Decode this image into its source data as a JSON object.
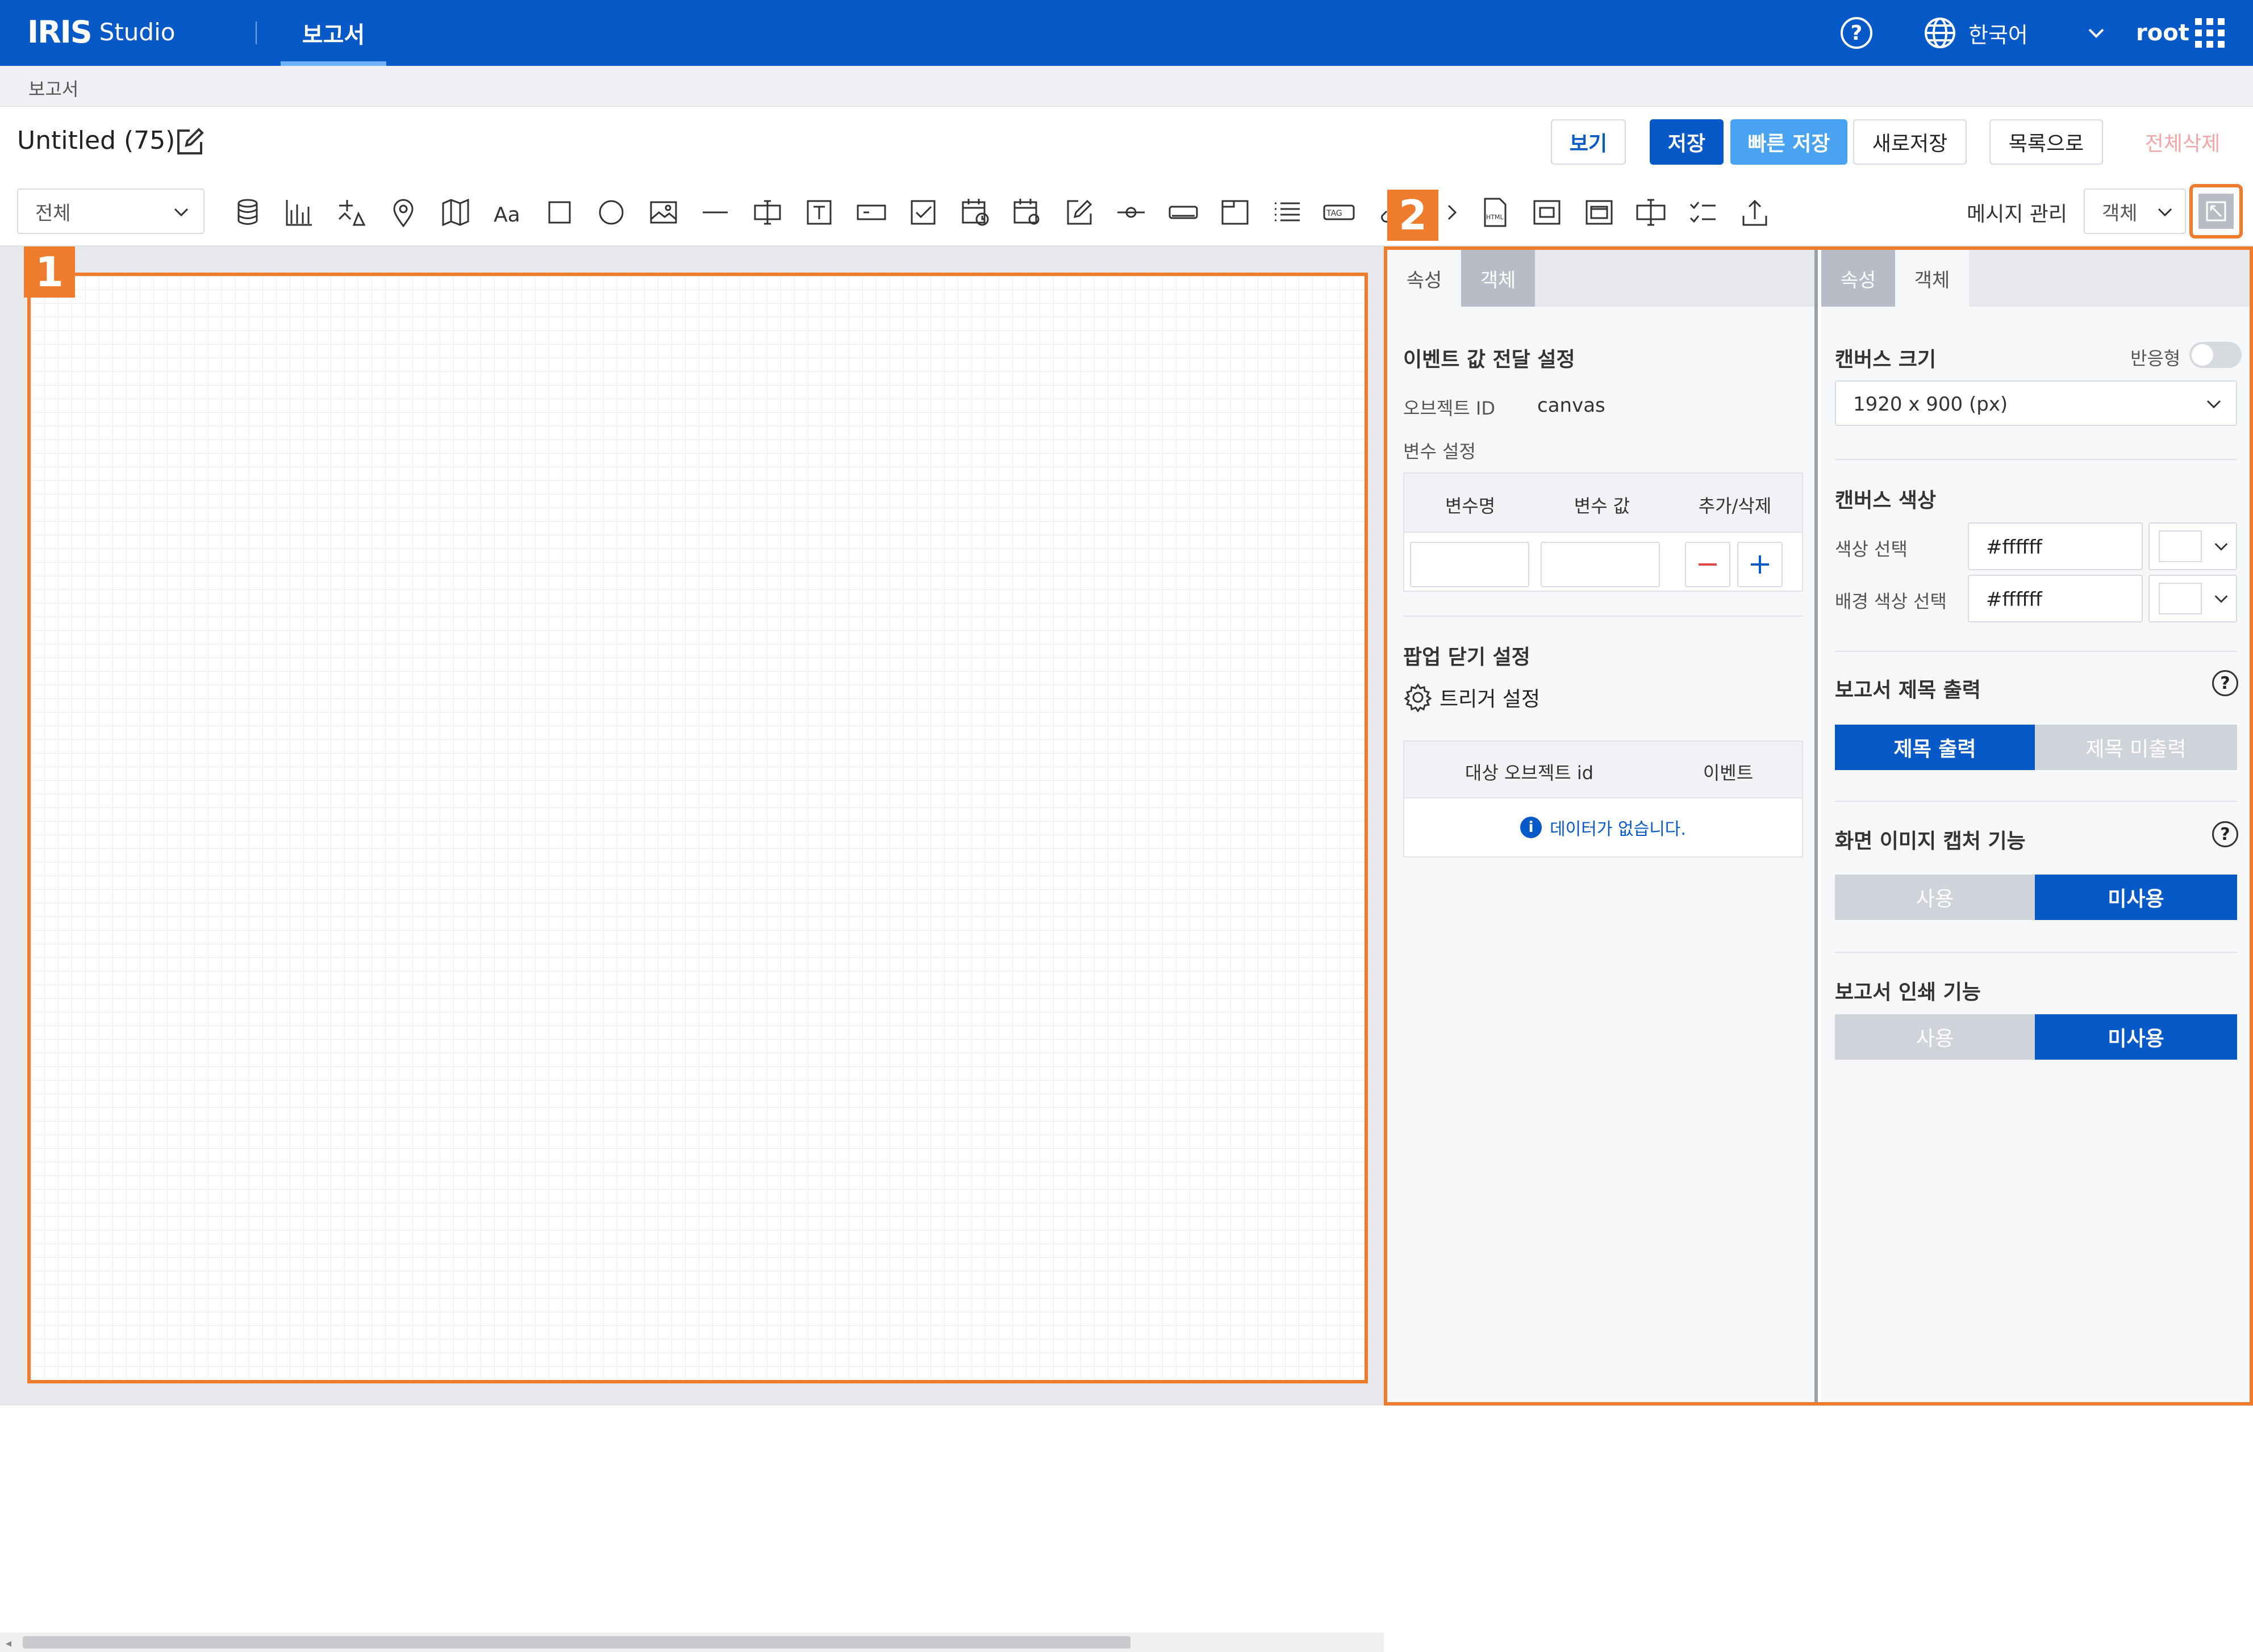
{
  "app": {
    "logo_mark": "IRIS",
    "logo_text": "Studio",
    "nav_tab": "보고서",
    "language": "한국어",
    "user": "root"
  },
  "breadcrumb": "보고서",
  "document": {
    "title": "Untitled (75)"
  },
  "actions": {
    "view": "보기",
    "save": "저장",
    "quick_save": "빠른 저장",
    "save_new": "새로저장",
    "to_list": "목록으로",
    "delete_all": "전체삭제"
  },
  "toolbar": {
    "filter_select": "전체",
    "message_manage": "메시지 관리",
    "object_select": "객체",
    "tools": [
      "database-icon",
      "bar-chart-icon",
      "filter-chart-icon",
      "map-pin-icon",
      "map-icon",
      "text-icon",
      "rectangle-icon",
      "circle-icon",
      "image-icon",
      "line-icon",
      "input-box-icon",
      "textbox-icon",
      "field-icon",
      "checkbox-icon",
      "date-icon",
      "datetime-icon",
      "edit-icon",
      "slider-icon",
      "button-icon",
      "tab-panel-icon",
      "list-icon",
      "tag-icon",
      "link-icon",
      "code-icon",
      "html-icon",
      "frame-icon",
      "popup-icon",
      "cursor-text-icon",
      "checklist-icon",
      "upload-icon"
    ]
  },
  "markers": {
    "canvas": "1",
    "panel": "2"
  },
  "left_panel": {
    "tab_props": "속성",
    "tab_object": "객체",
    "event_section": "이벤트 값 전달 설정",
    "object_id_label": "오브젝트 ID",
    "object_id_value": "canvas",
    "var_section": "변수 설정",
    "var_columns": [
      "변수명",
      "변수 값",
      "추가/삭제"
    ],
    "popup_section": "팝업 닫기 설정",
    "trigger_label": "트리거 설정",
    "trigger_columns": [
      "대상 오브젝트 id",
      "이벤트"
    ],
    "no_data": "데이터가 없습니다."
  },
  "right_panel": {
    "tab_props": "속성",
    "tab_object": "객체",
    "canvas_size_label": "캔버스 크기",
    "responsive_label": "반응형",
    "responsive_on": false,
    "canvas_size_value": "1920 x 900 (px)",
    "canvas_color_label": "캔버스 색상",
    "color_select_label": "색상 선택",
    "color_value": "#ffffff",
    "bg_color_label": "배경 색상 선택",
    "bg_color_value": "#ffffff",
    "title_output_label": "보고서 제목 출력",
    "title_on": "제목 출력",
    "title_off": "제목 미출력",
    "capture_label": "화면 이미지 캡처 기능",
    "capture_use": "사용",
    "capture_nouse": "미사용",
    "print_label": "보고서 인쇄 기능",
    "print_use": "사용",
    "print_nouse": "미사용"
  },
  "colors": {
    "brand": "#0759c8",
    "accent_orange": "#ef7b2d",
    "quick_save": "#4aa3f0",
    "danger": "#e04646"
  }
}
